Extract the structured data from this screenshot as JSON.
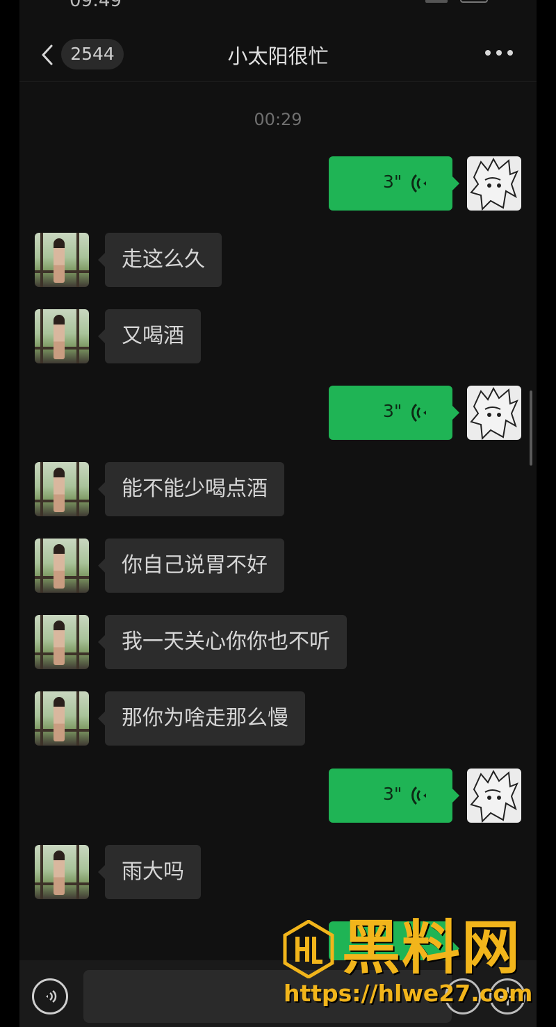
{
  "status_bar": {
    "time": "09:49"
  },
  "header": {
    "unread_count": "2544",
    "title": "小太阳很忙"
  },
  "timestamp": "00:29",
  "messages": [
    {
      "side": "out",
      "type": "voice",
      "duration": "3\""
    },
    {
      "side": "in",
      "type": "text",
      "text": "走这么久"
    },
    {
      "side": "in",
      "type": "text",
      "text": "又喝酒"
    },
    {
      "side": "out",
      "type": "voice",
      "duration": "3\""
    },
    {
      "side": "in",
      "type": "text",
      "text": "能不能少喝点酒"
    },
    {
      "side": "in",
      "type": "text",
      "text": "你自己说胃不好"
    },
    {
      "side": "in",
      "type": "text",
      "text": "我一天关心你你也不听"
    },
    {
      "side": "in",
      "type": "text",
      "text": "那你为啥走那么慢"
    },
    {
      "side": "out",
      "type": "voice",
      "duration": "3\""
    },
    {
      "side": "in",
      "type": "text",
      "text": "雨大吗"
    }
  ],
  "input": {
    "placeholder": ""
  },
  "watermark": {
    "title": "黑料网",
    "url": "https://hlwe27.com"
  },
  "colors": {
    "background": "#111111",
    "incoming_bubble": "#2c2c2c",
    "outgoing_bubble": "#1fb455",
    "watermark": "#f2b51b"
  },
  "icons": [
    "back-chevron-icon",
    "more-dots-icon",
    "voice-wave-icon",
    "voice-toggle-icon",
    "emoji-icon",
    "plus-icon"
  ]
}
